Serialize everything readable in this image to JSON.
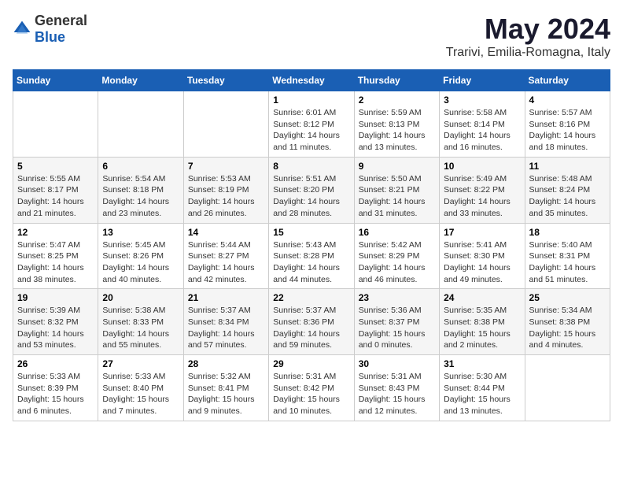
{
  "header": {
    "logo_general": "General",
    "logo_blue": "Blue",
    "month_year": "May 2024",
    "location": "Trarivi, Emilia-Romagna, Italy"
  },
  "weekdays": [
    "Sunday",
    "Monday",
    "Tuesday",
    "Wednesday",
    "Thursday",
    "Friday",
    "Saturday"
  ],
  "weeks": [
    [
      {
        "day": "",
        "sunrise": "",
        "sunset": "",
        "daylight": ""
      },
      {
        "day": "",
        "sunrise": "",
        "sunset": "",
        "daylight": ""
      },
      {
        "day": "",
        "sunrise": "",
        "sunset": "",
        "daylight": ""
      },
      {
        "day": "1",
        "sunrise": "Sunrise: 6:01 AM",
        "sunset": "Sunset: 8:12 PM",
        "daylight": "Daylight: 14 hours and 11 minutes."
      },
      {
        "day": "2",
        "sunrise": "Sunrise: 5:59 AM",
        "sunset": "Sunset: 8:13 PM",
        "daylight": "Daylight: 14 hours and 13 minutes."
      },
      {
        "day": "3",
        "sunrise": "Sunrise: 5:58 AM",
        "sunset": "Sunset: 8:14 PM",
        "daylight": "Daylight: 14 hours and 16 minutes."
      },
      {
        "day": "4",
        "sunrise": "Sunrise: 5:57 AM",
        "sunset": "Sunset: 8:16 PM",
        "daylight": "Daylight: 14 hours and 18 minutes."
      }
    ],
    [
      {
        "day": "5",
        "sunrise": "Sunrise: 5:55 AM",
        "sunset": "Sunset: 8:17 PM",
        "daylight": "Daylight: 14 hours and 21 minutes."
      },
      {
        "day": "6",
        "sunrise": "Sunrise: 5:54 AM",
        "sunset": "Sunset: 8:18 PM",
        "daylight": "Daylight: 14 hours and 23 minutes."
      },
      {
        "day": "7",
        "sunrise": "Sunrise: 5:53 AM",
        "sunset": "Sunset: 8:19 PM",
        "daylight": "Daylight: 14 hours and 26 minutes."
      },
      {
        "day": "8",
        "sunrise": "Sunrise: 5:51 AM",
        "sunset": "Sunset: 8:20 PM",
        "daylight": "Daylight: 14 hours and 28 minutes."
      },
      {
        "day": "9",
        "sunrise": "Sunrise: 5:50 AM",
        "sunset": "Sunset: 8:21 PM",
        "daylight": "Daylight: 14 hours and 31 minutes."
      },
      {
        "day": "10",
        "sunrise": "Sunrise: 5:49 AM",
        "sunset": "Sunset: 8:22 PM",
        "daylight": "Daylight: 14 hours and 33 minutes."
      },
      {
        "day": "11",
        "sunrise": "Sunrise: 5:48 AM",
        "sunset": "Sunset: 8:24 PM",
        "daylight": "Daylight: 14 hours and 35 minutes."
      }
    ],
    [
      {
        "day": "12",
        "sunrise": "Sunrise: 5:47 AM",
        "sunset": "Sunset: 8:25 PM",
        "daylight": "Daylight: 14 hours and 38 minutes."
      },
      {
        "day": "13",
        "sunrise": "Sunrise: 5:45 AM",
        "sunset": "Sunset: 8:26 PM",
        "daylight": "Daylight: 14 hours and 40 minutes."
      },
      {
        "day": "14",
        "sunrise": "Sunrise: 5:44 AM",
        "sunset": "Sunset: 8:27 PM",
        "daylight": "Daylight: 14 hours and 42 minutes."
      },
      {
        "day": "15",
        "sunrise": "Sunrise: 5:43 AM",
        "sunset": "Sunset: 8:28 PM",
        "daylight": "Daylight: 14 hours and 44 minutes."
      },
      {
        "day": "16",
        "sunrise": "Sunrise: 5:42 AM",
        "sunset": "Sunset: 8:29 PM",
        "daylight": "Daylight: 14 hours and 46 minutes."
      },
      {
        "day": "17",
        "sunrise": "Sunrise: 5:41 AM",
        "sunset": "Sunset: 8:30 PM",
        "daylight": "Daylight: 14 hours and 49 minutes."
      },
      {
        "day": "18",
        "sunrise": "Sunrise: 5:40 AM",
        "sunset": "Sunset: 8:31 PM",
        "daylight": "Daylight: 14 hours and 51 minutes."
      }
    ],
    [
      {
        "day": "19",
        "sunrise": "Sunrise: 5:39 AM",
        "sunset": "Sunset: 8:32 PM",
        "daylight": "Daylight: 14 hours and 53 minutes."
      },
      {
        "day": "20",
        "sunrise": "Sunrise: 5:38 AM",
        "sunset": "Sunset: 8:33 PM",
        "daylight": "Daylight: 14 hours and 55 minutes."
      },
      {
        "day": "21",
        "sunrise": "Sunrise: 5:37 AM",
        "sunset": "Sunset: 8:34 PM",
        "daylight": "Daylight: 14 hours and 57 minutes."
      },
      {
        "day": "22",
        "sunrise": "Sunrise: 5:37 AM",
        "sunset": "Sunset: 8:36 PM",
        "daylight": "Daylight: 14 hours and 59 minutes."
      },
      {
        "day": "23",
        "sunrise": "Sunrise: 5:36 AM",
        "sunset": "Sunset: 8:37 PM",
        "daylight": "Daylight: 15 hours and 0 minutes."
      },
      {
        "day": "24",
        "sunrise": "Sunrise: 5:35 AM",
        "sunset": "Sunset: 8:38 PM",
        "daylight": "Daylight: 15 hours and 2 minutes."
      },
      {
        "day": "25",
        "sunrise": "Sunrise: 5:34 AM",
        "sunset": "Sunset: 8:38 PM",
        "daylight": "Daylight: 15 hours and 4 minutes."
      }
    ],
    [
      {
        "day": "26",
        "sunrise": "Sunrise: 5:33 AM",
        "sunset": "Sunset: 8:39 PM",
        "daylight": "Daylight: 15 hours and 6 minutes."
      },
      {
        "day": "27",
        "sunrise": "Sunrise: 5:33 AM",
        "sunset": "Sunset: 8:40 PM",
        "daylight": "Daylight: 15 hours and 7 minutes."
      },
      {
        "day": "28",
        "sunrise": "Sunrise: 5:32 AM",
        "sunset": "Sunset: 8:41 PM",
        "daylight": "Daylight: 15 hours and 9 minutes."
      },
      {
        "day": "29",
        "sunrise": "Sunrise: 5:31 AM",
        "sunset": "Sunset: 8:42 PM",
        "daylight": "Daylight: 15 hours and 10 minutes."
      },
      {
        "day": "30",
        "sunrise": "Sunrise: 5:31 AM",
        "sunset": "Sunset: 8:43 PM",
        "daylight": "Daylight: 15 hours and 12 minutes."
      },
      {
        "day": "31",
        "sunrise": "Sunrise: 5:30 AM",
        "sunset": "Sunset: 8:44 PM",
        "daylight": "Daylight: 15 hours and 13 minutes."
      },
      {
        "day": "",
        "sunrise": "",
        "sunset": "",
        "daylight": ""
      }
    ]
  ]
}
